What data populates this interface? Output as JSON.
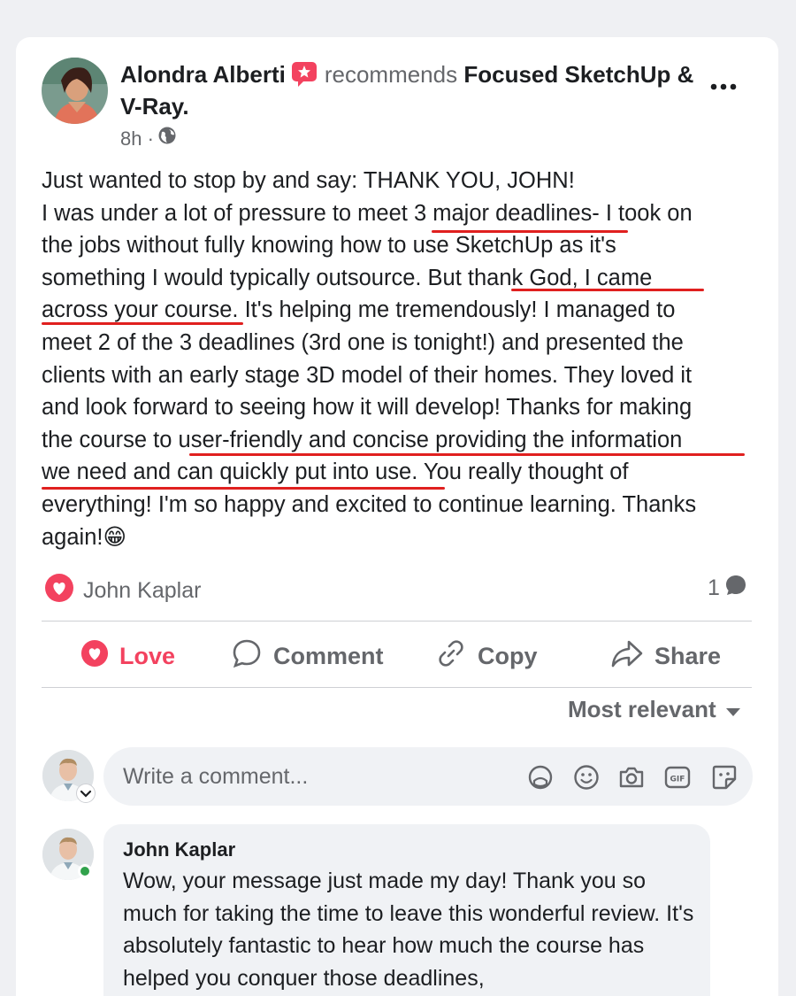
{
  "post": {
    "author": "Alondra Alberti",
    "recommends_text": "recommends",
    "page_name": "Focused SketchUp & V-Ray.",
    "time": "8h ·",
    "body_lines": [
      "Just wanted to stop by and say: THANK YOU, JOHN!",
      "I was under a lot of pressure to meet 3 major deadlines- I took on",
      "the jobs without fully knowing how to use SketchUp as it's",
      "something I would typically outsource. But thank God, I came",
      "across your course. It's helping me tremendously! I managed to",
      "meet 2 of the 3 deadlines (3rd one is tonight!) and presented the",
      "clients with an early stage 3D model of their homes. They loved it",
      "and look forward to seeing how it will develop! Thanks for making",
      "the course to user-friendly and concise providing the information",
      "we need and can quickly put into use. You really thought of",
      "everything! I'm so happy and excited to continue learning. Thanks",
      "again!😁"
    ],
    "reactor": "John Kaplar",
    "comment_count": "1"
  },
  "actions": {
    "love": "Love",
    "comment": "Comment",
    "copy": "Copy",
    "share": "Share"
  },
  "sort_label": "Most relevant",
  "composer": {
    "placeholder": "Write a comment..."
  },
  "reply": {
    "author": "John Kaplar",
    "text": "Wow, your message just made my day! Thank you so much for taking the time to leave this wonderful review. It's absolutely fantastic to hear how much the course has helped you conquer those deadlines,"
  },
  "colors": {
    "love": "#f3425f",
    "underline": "#e0201f",
    "muted": "#65676b",
    "online": "#31a24c"
  },
  "icons": {
    "badge": "recommendation-star-badge-icon",
    "globe": "globe-icon",
    "more": "more-dots-icon",
    "heart": "heart-icon",
    "comment": "comment-bubble-icon",
    "copy": "link-icon",
    "share": "share-arrow-icon",
    "caret": "caret-down-icon",
    "sticker": "sticker-icon",
    "emoji": "emoji-icon",
    "camera": "camera-icon",
    "gif": "gif-icon",
    "avatar_sticker": "avatar-sticker-icon"
  }
}
